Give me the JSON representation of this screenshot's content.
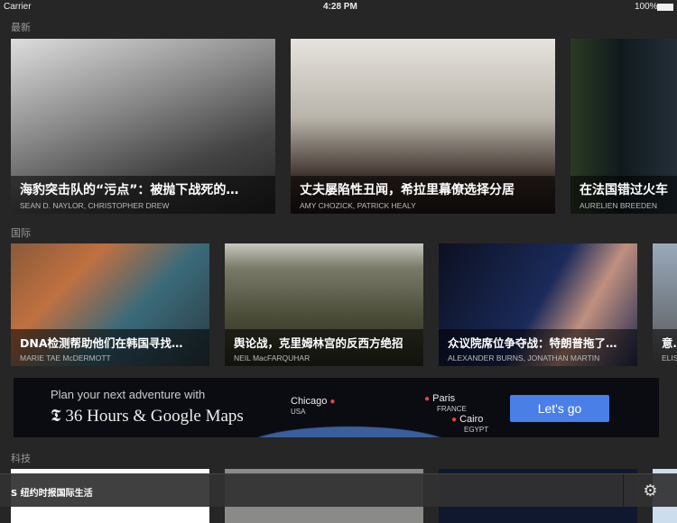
{
  "status": {
    "carrier": "Carrier",
    "time": "4:28 PM",
    "battery": "100%"
  },
  "sections": [
    {
      "title": "最新",
      "articles": [
        {
          "headline": "海豹突击队的“污点”：被抛下战死的…",
          "authors": "SEAN D. NAYLOR, CHRISTOPHER DREW"
        },
        {
          "headline": "丈夫屡陷性丑闻，希拉里幕僚选择分居",
          "authors": "AMY CHOZICK, PATRICK HEALY"
        },
        {
          "headline": "在法国错过火车",
          "authors": "AURELIEN BREEDEN"
        }
      ]
    },
    {
      "title": "国际",
      "articles": [
        {
          "headline": "DNA检测帮助他们在韩国寻找…",
          "authors": "MARIE TAE McDERMOTT"
        },
        {
          "headline": "舆论战，克里姆林宫的反西方绝招",
          "authors": "NEIL MacFARQUHAR"
        },
        {
          "headline": "众议院席位争夺战：特朗普拖了…",
          "authors": "ALEXANDER BURNS, JONATHAN MARTIN"
        },
        {
          "headline": "意…",
          "authors": "ELIS"
        }
      ]
    },
    {
      "title": "科技"
    }
  ],
  "ad": {
    "line1": "Plan your next adventure with",
    "line2": "𝕿 36 Hours & Google Maps",
    "cities": [
      {
        "name": "Chicago",
        "country": "USA"
      },
      {
        "name": "Paris",
        "country": "FRANCE"
      },
      {
        "name": "Cairo",
        "country": "EGYPT"
      }
    ],
    "cta": "Let's go"
  },
  "bottom": {
    "brand": "S 纽约时报国际生活"
  }
}
